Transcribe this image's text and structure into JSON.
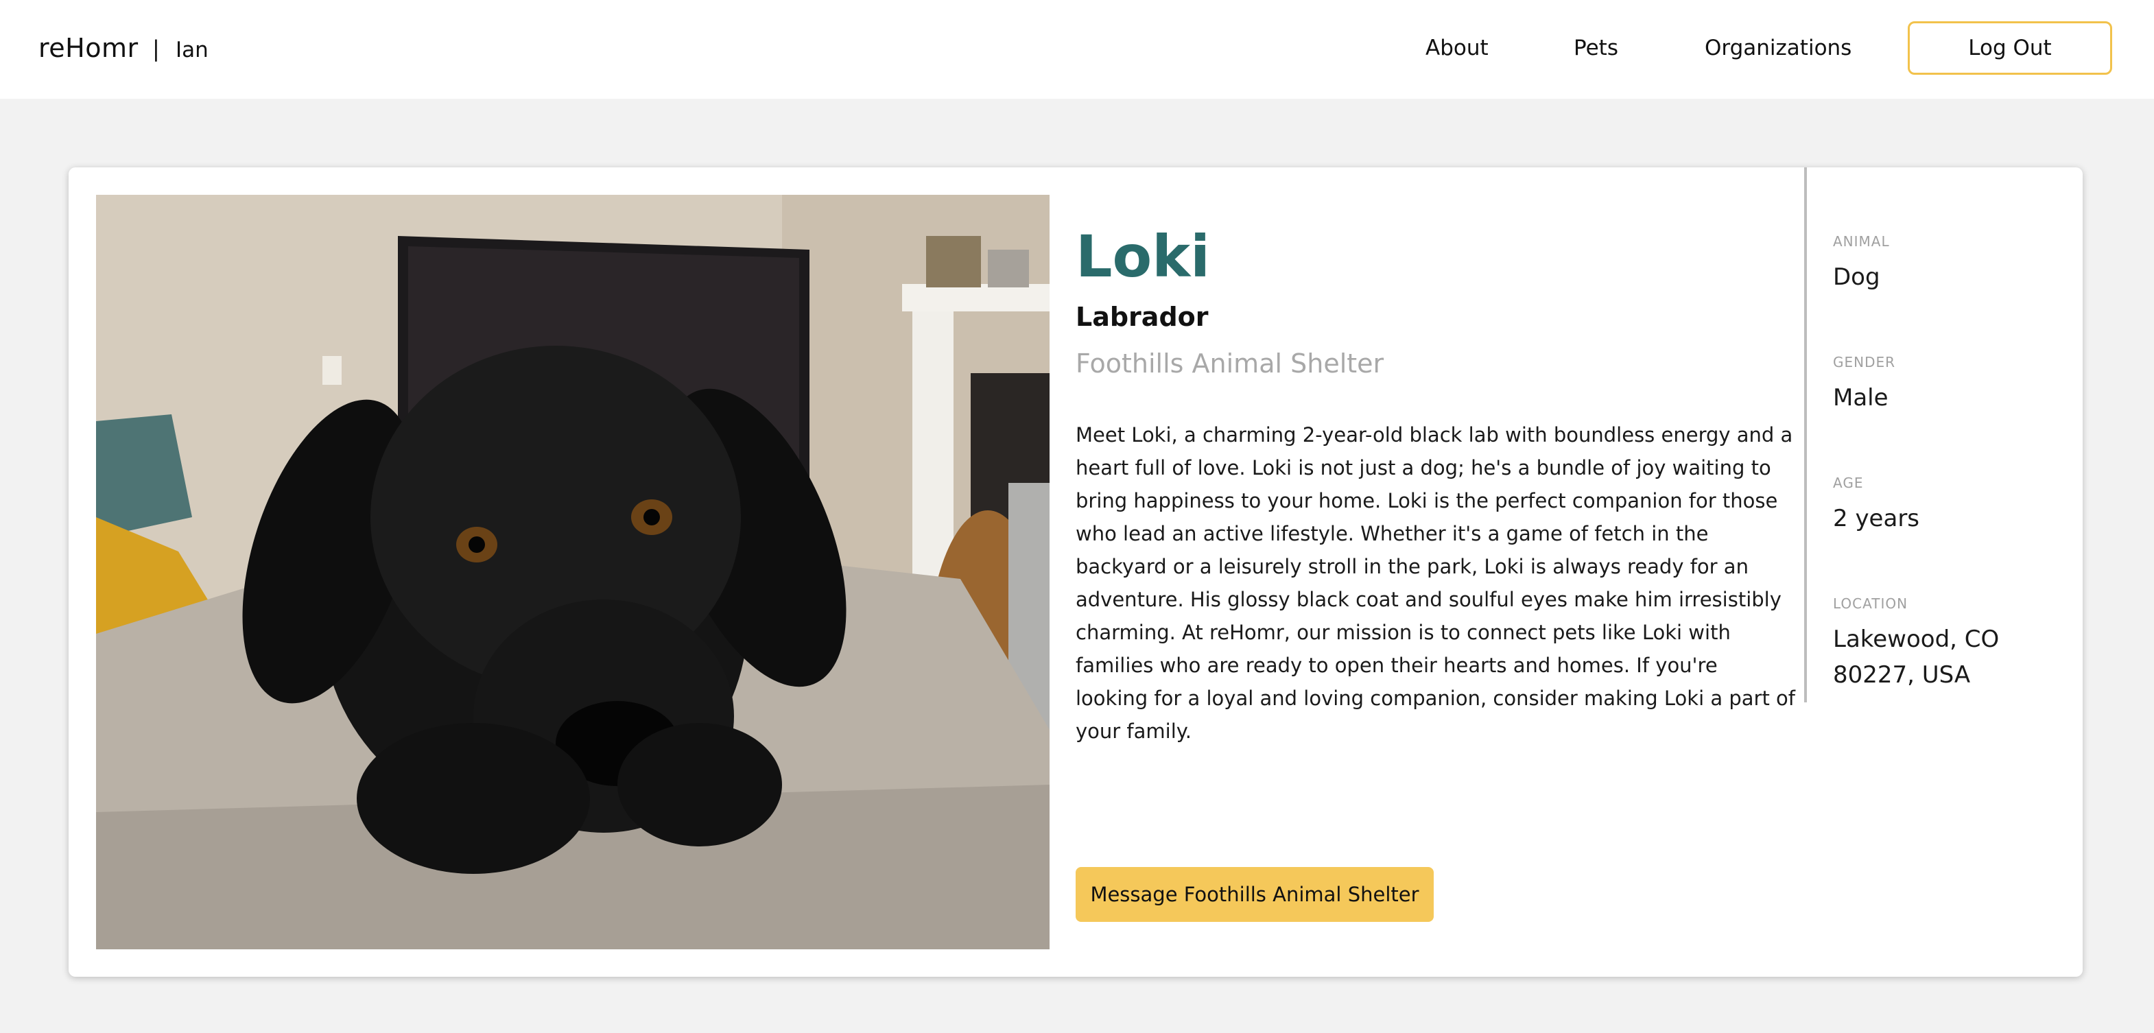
{
  "header": {
    "brand": "reHomr",
    "separator": "|",
    "user": "Ian",
    "nav": [
      {
        "label": "About"
      },
      {
        "label": "Pets"
      },
      {
        "label": "Organizations"
      }
    ],
    "logout_label": "Log Out"
  },
  "pet": {
    "name": "Loki",
    "breed": "Labrador",
    "organization": "Foothills Animal Shelter",
    "description": "Meet Loki, a charming 2-year-old black lab with boundless energy and a heart full of love. Loki is not just a dog; he's a bundle of joy waiting to bring happiness to your home. Loki is the perfect companion for those who lead an active lifestyle. Whether it's a game of fetch in the backyard or a leisurely stroll in the park, Loki is always ready for an adventure. His glossy black coat and soulful eyes make him irresistibly charming. At reHomr, our mission is to connect pets like Loki with families who are ready to open their hearts and homes. If you're looking for a loyal and loving companion, consider making Loki a part of your family.",
    "message_button": "Message Foothills Animal Shelter",
    "facts": [
      {
        "label": "ANIMAL",
        "value": "Dog"
      },
      {
        "label": "GENDER",
        "value": "Male"
      },
      {
        "label": "AGE",
        "value": "2 years"
      },
      {
        "label": "LOCATION",
        "value": "Lakewood, CO 80227, USA"
      }
    ]
  },
  "colors": {
    "accent_yellow": "#f5c85a",
    "logout_border": "#f2c24c",
    "name_teal": "#2a6b6b",
    "org_gray": "#a8a8a8",
    "page_bg": "#f2f2f2"
  }
}
